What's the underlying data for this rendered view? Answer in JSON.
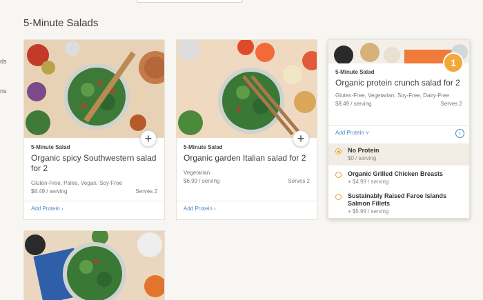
{
  "section_title": "5-Minute Salads",
  "side_fragments": [
    "ds",
    "ns"
  ],
  "cards": [
    {
      "tag": "5-Minute Salad",
      "name": "Organic spicy Southwestern salad for 2",
      "diet": "Gluten-Free, Paleo, Vegan, Soy-Free",
      "price": "$8.49 / serving",
      "serves": "Serves 2",
      "add_protein": "Add Protein ›",
      "plus": "+"
    },
    {
      "tag": "5-Minute Salad",
      "name": "Organic garden Italian salad for 2",
      "diet": "Vegetarian",
      "price": "$6.99 / serving",
      "serves": "Serves 2",
      "add_protein": "Add Protein ›",
      "plus": "+"
    },
    {
      "tag": "5-Minute Salad",
      "name": "Organic protein crunch salad for 2",
      "diet": "Gluten-Free, Vegetarian, Soy-Free, Dairy-Free",
      "price": "$8.49 / serving",
      "serves": "Serves 2",
      "add_protein": "Add Protein ˅",
      "badge": "1",
      "info": "i",
      "protein_options": [
        {
          "name": "No Protein",
          "price": "$0 / serving",
          "selected": true
        },
        {
          "name": "Organic Grilled Chicken Breasts",
          "price": "+ $4.99 / serving",
          "selected": false
        },
        {
          "name": "Sustainably Raised Faroe Islands Salmon Fillets",
          "price": "+ $5.99 / serving",
          "selected": false
        }
      ]
    }
  ],
  "colors": {
    "accent": "#4a86c5",
    "badge": "#f2a93b",
    "radio": "#e3a23a"
  }
}
